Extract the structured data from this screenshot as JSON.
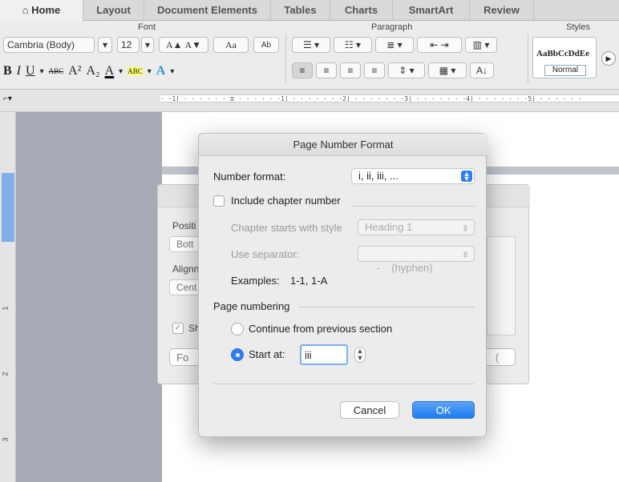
{
  "tabs": [
    {
      "label": "Home",
      "icon": "home-icon"
    },
    {
      "label": "Layout"
    },
    {
      "label": "Document Elements"
    },
    {
      "label": "Tables"
    },
    {
      "label": "Charts"
    },
    {
      "label": "SmartArt"
    },
    {
      "label": "Review"
    }
  ],
  "ribbon": {
    "font_group": "Font",
    "paragraph_group": "Paragraph",
    "styles_group": "Styles",
    "font_name": "Cambria (Body)",
    "font_size": "12",
    "bold": "B",
    "italic": "I",
    "underline": "U",
    "strike": "ABC",
    "superscript": "A²",
    "subscript": "A₂",
    "grow": "A▲",
    "shrink": "A▼",
    "change_case": "Aa",
    "clear": "Ab",
    "font_color": "A",
    "highlight": "ABC",
    "text_effects": "A",
    "style_preview": "AaBbCcDdEe",
    "style_name": "Normal"
  },
  "ruler": {
    "marks": "· ·1| · · · · · · ⧖ · · · · · ·1| · · · · · · ·2| · · · · · · ·3| · · · · · · ·4| · · · · · · ·5| · · · · · ·",
    "vmarks": [
      "1",
      "2",
      "3"
    ]
  },
  "back_dialog": {
    "position_label": "Positi",
    "position_value": "Bott",
    "alignment_label": "Alignn",
    "alignment_value": "Cent",
    "show_label": "Sh",
    "format_button": "Fo",
    "ok_partial": "("
  },
  "dialog": {
    "title": "Page Number Format",
    "number_format_label": "Number format:",
    "number_format_value": "i, ii, iii, ...",
    "include_chapter_label": "Include chapter number",
    "chapter_style_label": "Chapter starts with style",
    "chapter_style_value": "Heading 1",
    "separator_label": "Use separator:",
    "separator_value": "-    (hyphen)",
    "examples_label": "Examples:",
    "examples_value": "1-1, 1-A",
    "page_numbering_label": "Page numbering",
    "continue_label": "Continue from previous section",
    "start_at_label": "Start at:",
    "start_at_value": "iii",
    "cancel_button": "Cancel",
    "ok_button": "OK"
  },
  "colors": {
    "accent": "#2f7ef5",
    "ribbon": "#ececec",
    "sidebar": "#a5aab4"
  }
}
